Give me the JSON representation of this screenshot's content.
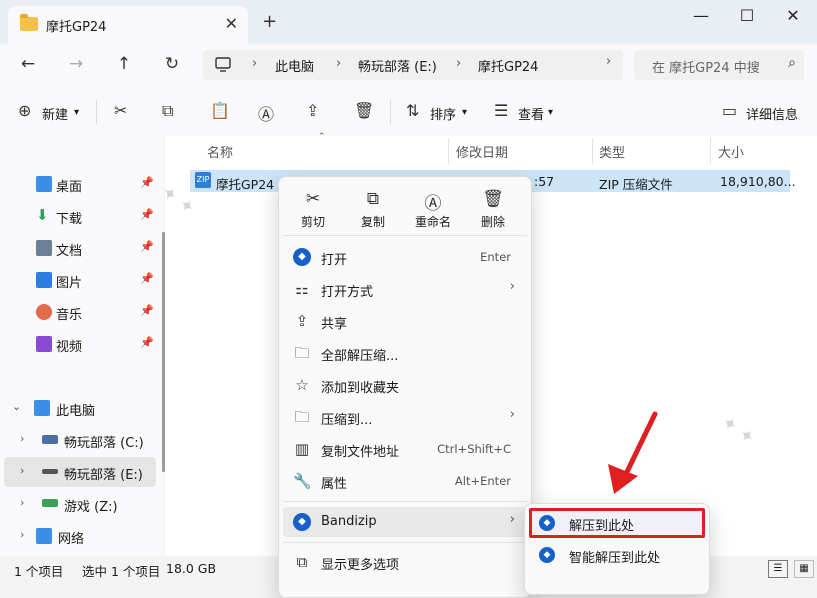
{
  "window": {
    "tab_title": "摩托GP24",
    "tab_close": "✕",
    "new_tab": "+",
    "min": "—",
    "max": "☐",
    "close": "✕"
  },
  "nav": {
    "back": "←",
    "forward": "→",
    "up": "↑",
    "refresh": "↻"
  },
  "breadcrumb": [
    "此电脑",
    "畅玩部落 (E:)",
    "摩托GP24"
  ],
  "search": {
    "placeholder": "在 摩托GP24 中搜"
  },
  "toolbar": {
    "new_label": "新建",
    "sort_label": "排序",
    "view_label": "查看",
    "details_label": "详细信息"
  },
  "sidebar": {
    "quick": [
      {
        "label": "桌面",
        "icon": "desktop-icon",
        "color": "#3a8ee6"
      },
      {
        "label": "下载",
        "icon": "download-icon",
        "color": "#2ea05a"
      },
      {
        "label": "文档",
        "icon": "document-icon",
        "color": "#6b7f99"
      },
      {
        "label": "图片",
        "icon": "pictures-icon",
        "color": "#2c7de0"
      },
      {
        "label": "音乐",
        "icon": "music-icon",
        "color": "#e2694a"
      },
      {
        "label": "视频",
        "icon": "video-icon",
        "color": "#8a4bd4"
      }
    ],
    "this_pc": "此电脑",
    "drives": [
      "畅玩部落 (C:)",
      "畅玩部落 (E:)",
      "游戏 (Z:)"
    ],
    "network": "网络"
  },
  "columns": {
    "name": "名称",
    "modified": "修改日期",
    "type": "类型",
    "size": "大小"
  },
  "file": {
    "name": "摩托GP24",
    "modified_tail": ":57",
    "type": "ZIP 压缩文件",
    "size": "18,910,80..."
  },
  "context_menu": {
    "quick_actions": [
      "剪切",
      "复制",
      "重命名",
      "删除"
    ],
    "items": [
      {
        "label": "打开",
        "shortcut": "Enter"
      },
      {
        "label": "打开方式",
        "arrow": "›"
      },
      {
        "label": "共享"
      },
      {
        "label": "全部解压缩..."
      },
      {
        "label": "添加到收藏夹"
      },
      {
        "label": "压缩到...",
        "arrow": "›"
      },
      {
        "label": "复制文件地址",
        "shortcut": "Ctrl+Shift+C"
      },
      {
        "label": "属性",
        "shortcut": "Alt+Enter"
      },
      {
        "label": "Bandizip",
        "arrow": "›"
      },
      {
        "label": "显示更多选项"
      }
    ]
  },
  "submenu": [
    "解压到此处",
    "智能解压到此处"
  ],
  "status": {
    "count": "1 个项目",
    "selected": "选中 1 个项目",
    "size": "18.0 GB"
  },
  "colors": {
    "highlight_red": "#e02020",
    "selection": "#cce4f7",
    "bandizip_blue": "#1660c9"
  }
}
